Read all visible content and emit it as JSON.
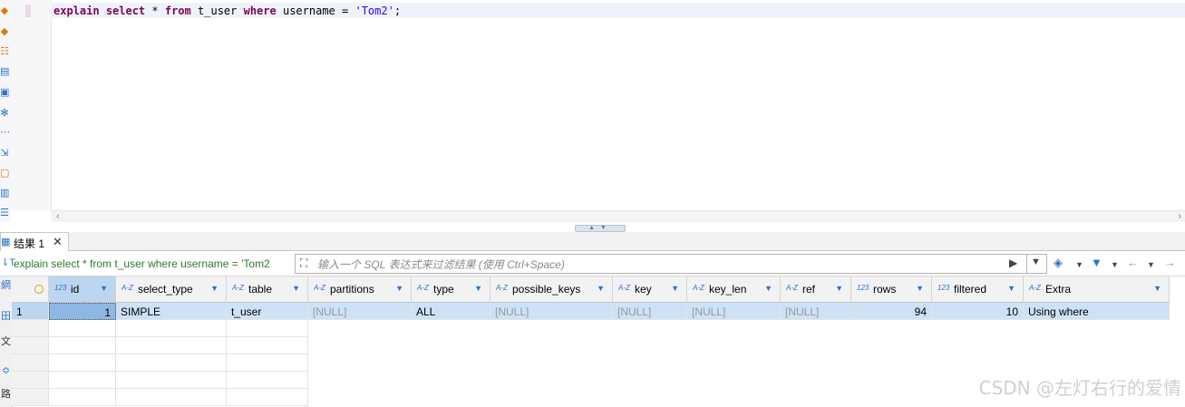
{
  "editor": {
    "sql_tokens": {
      "k1": "explain",
      "k2": "select",
      "p1": "*",
      "k3": "from",
      "p2": "t_user",
      "k4": "where",
      "p3": "username",
      "p4": "=",
      "s1": "'Tom2'",
      "p5": ";"
    }
  },
  "results_tab": {
    "label": "结果 1",
    "close": "✕"
  },
  "filter": {
    "query_text": "explain select * from t_user where username = 'Tom2",
    "placeholder": "输入一个 SQL 表达式来过滤结果 (使用 Ctrl+Space)"
  },
  "grid": {
    "columns": [
      {
        "name": "id",
        "type_icon": "123"
      },
      {
        "name": "select_type",
        "type_icon": "A-Z"
      },
      {
        "name": "table",
        "type_icon": "A-Z"
      },
      {
        "name": "partitions",
        "type_icon": "A-Z"
      },
      {
        "name": "type",
        "type_icon": "A-Z"
      },
      {
        "name": "possible_keys",
        "type_icon": "A-Z"
      },
      {
        "name": "key",
        "type_icon": "A-Z"
      },
      {
        "name": "key_len",
        "type_icon": "A-Z"
      },
      {
        "name": "ref",
        "type_icon": "A-Z"
      },
      {
        "name": "rows",
        "type_icon": "123"
      },
      {
        "name": "filtered",
        "type_icon": "123"
      },
      {
        "name": "Extra",
        "type_icon": "A-Z"
      }
    ],
    "rows": [
      {
        "rownum": "1",
        "id": "1",
        "select_type": "SIMPLE",
        "table": "t_user",
        "partitions": "[NULL]",
        "type": "ALL",
        "possible_keys": "[NULL]",
        "key": "[NULL]",
        "key_len": "[NULL]",
        "ref": "[NULL]",
        "rows": "94",
        "filtered": "10",
        "Extra": "Using where"
      }
    ]
  },
  "side_tabs": [
    "網",
    "田",
    "文",
    "≎",
    "路"
  ],
  "watermark": "CSDN @左灯右行的爱情",
  "colors": {
    "keyword": "#7f0055",
    "string": "#2a00ff",
    "selected_row": "#cde2f7",
    "accent": "#2b72c9"
  },
  "icons": [
    "run-script-icon",
    "explain-icon",
    "settings-icon",
    "close-icon",
    "eraser-icon",
    "filter-icon",
    "back-icon",
    "forward-icon"
  ]
}
